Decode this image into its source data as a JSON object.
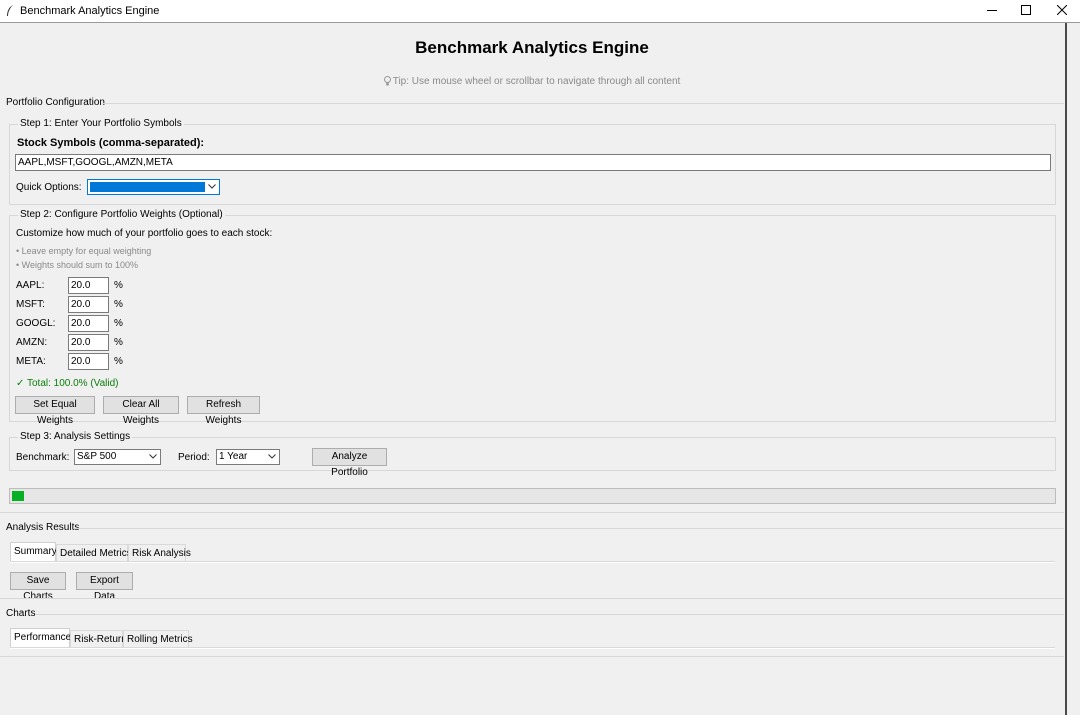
{
  "window": {
    "title": "Benchmark Analytics Engine"
  },
  "header": {
    "title": "Benchmark Analytics Engine",
    "tip": "Tip: Use mouse wheel or scrollbar to navigate through all content"
  },
  "portfolio": {
    "label": "Portfolio Configuration",
    "step1": {
      "label": "Step 1: Enter Your Portfolio Symbols",
      "symbols_label": "Stock Symbols (comma-separated):",
      "symbols_value": "AAPL,MSFT,GOOGL,AMZN,META",
      "quick_label": "Quick Options:",
      "quick_value": ""
    },
    "step2": {
      "label": "Step 2: Configure Portfolio Weights (Optional)",
      "intro": "Customize how much of your portfolio goes to each stock:",
      "hint1": "• Leave empty for equal weighting",
      "hint2": "• Weights should sum to 100%",
      "weights": [
        {
          "symbol": "AAPL:",
          "value": "20.0",
          "unit": "%"
        },
        {
          "symbol": "MSFT:",
          "value": "20.0",
          "unit": "%"
        },
        {
          "symbol": "GOOGL:",
          "value": "20.0",
          "unit": "%"
        },
        {
          "symbol": "AMZN:",
          "value": "20.0",
          "unit": "%"
        },
        {
          "symbol": "META:",
          "value": "20.0",
          "unit": "%"
        }
      ],
      "total": "✓ Total: 100.0% (Valid)",
      "buttons": {
        "equal": "Set Equal Weights",
        "clear": "Clear All Weights",
        "refresh": "Refresh Weights"
      }
    },
    "step3": {
      "label": "Step 3: Analysis Settings",
      "benchmark_label": "Benchmark:",
      "benchmark_value": "S&P 500",
      "period_label": "Period:",
      "period_value": "1 Year",
      "analyze": "Analyze Portfolio"
    },
    "progress": 0.012
  },
  "results": {
    "label": "Analysis Results",
    "tabs": [
      "Summary",
      "Detailed Metrics",
      "Risk Analysis"
    ],
    "save": "Save Charts",
    "export": "Export Data"
  },
  "charts": {
    "label": "Charts",
    "tabs": [
      "Performance",
      "Risk-Return",
      "Rolling Metrics"
    ]
  },
  "colors": {
    "accent": "#0078d7",
    "progress": "#06b025",
    "valid": "#0a7d0a"
  }
}
